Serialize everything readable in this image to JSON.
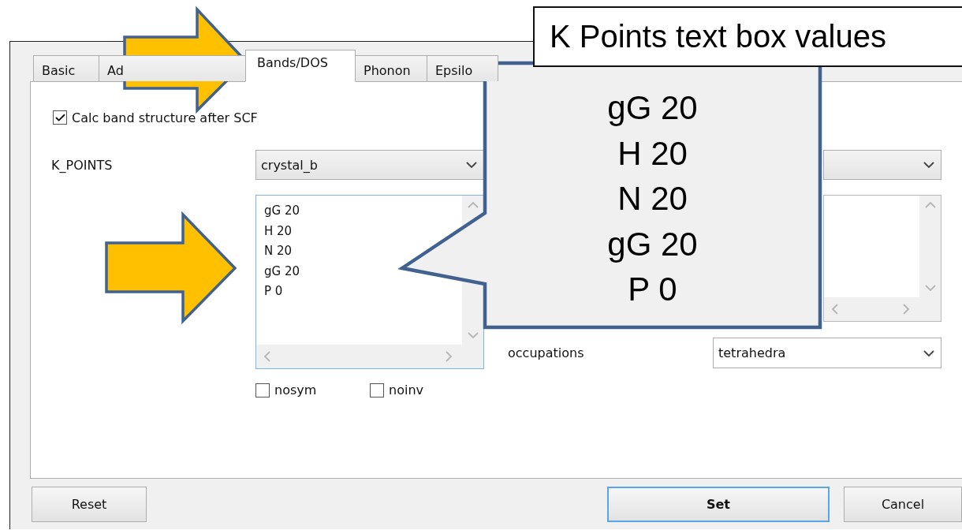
{
  "tabs": [
    {
      "label": "Basic",
      "selected": false
    },
    {
      "label": "Ad",
      "selected": false
    },
    {
      "label": "Bands/DOS",
      "selected": true
    },
    {
      "label": "Phonon",
      "selected": false
    },
    {
      "label": "Epsilo",
      "selected": false
    }
  ],
  "calc_band_structure": {
    "label": "Calc band structure after SCF",
    "checked": true
  },
  "k_points": {
    "label": "K_POINTS",
    "value": "crystal_b",
    "lines": [
      "gG 20",
      "H 20",
      "N 20",
      "gG 20",
      "P 0"
    ]
  },
  "occupations": {
    "label": "occupations",
    "value": "tetrahedra"
  },
  "options": [
    {
      "label": "nosym",
      "checked": false
    },
    {
      "label": "noinv",
      "checked": false
    }
  ],
  "buttons": [
    {
      "label": "Reset",
      "focused": false
    },
    {
      "label": "Set",
      "focused": true
    },
    {
      "label": "Cancel",
      "focused": false
    }
  ],
  "annotation": {
    "title": "K Points text box values",
    "callout_lines": [
      "gG 20",
      "H 20",
      "N 20",
      "gG 20",
      "P 0"
    ]
  }
}
